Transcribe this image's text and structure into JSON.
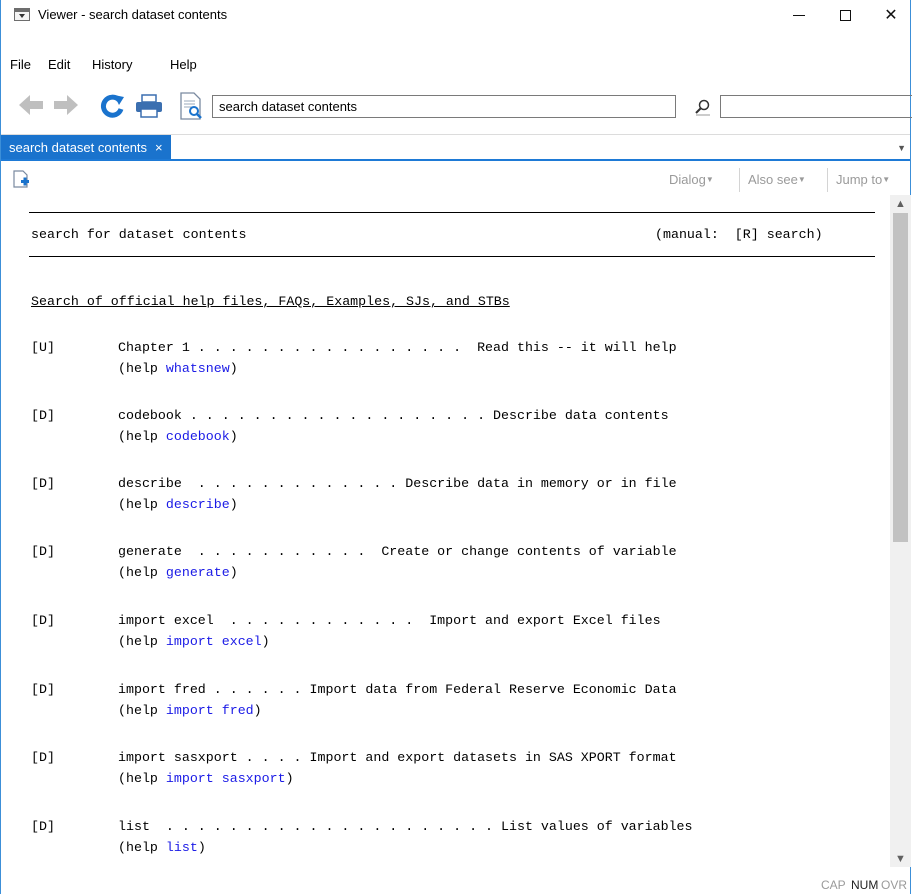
{
  "window": {
    "title": "Viewer - search dataset contents"
  },
  "menu": [
    "File",
    "Edit",
    "History",
    "Help"
  ],
  "toolbar": {
    "address": "search dataset contents",
    "search_value": ""
  },
  "tab": {
    "label": "search dataset contents",
    "close": "×"
  },
  "subbar": {
    "dialog": "Dialog",
    "also_see": "Also see",
    "jump_to": "Jump to"
  },
  "content": {
    "header_title": "search for dataset contents",
    "header_manual": "(manual:  [R] search)",
    "section_title": "Search of official help files, FAQs, Examples, SJs, and STBs",
    "entries": [
      {
        "tag": "[U]",
        "text": "Chapter 1 . . . . . . . . . . . . . . . . .  Read this -- it will help",
        "help_prefix": "(help ",
        "help_link": "whatsnew",
        "help_suffix": ")"
      },
      {
        "tag": "[D]",
        "text": "codebook . . . . . . . . . . . . . . . . . . . Describe data contents",
        "help_prefix": "(help ",
        "help_link": "codebook",
        "help_suffix": ")"
      },
      {
        "tag": "[D]",
        "text": "describe  . . . . . . . . . . . . . Describe data in memory or in file",
        "help_prefix": "(help ",
        "help_link": "describe",
        "help_suffix": ")"
      },
      {
        "tag": "[D]",
        "text": "generate  . . . . . . . . . . .  Create or change contents of variable",
        "help_prefix": "(help ",
        "help_link": "generate",
        "help_suffix": ")"
      },
      {
        "tag": "[D]",
        "text": "import excel  . . . . . . . . . . . .  Import and export Excel files",
        "help_prefix": "(help ",
        "help_link": "import excel",
        "help_suffix": ")"
      },
      {
        "tag": "[D]",
        "text": "import fred . . . . . . Import data from Federal Reserve Economic Data",
        "help_prefix": "(help ",
        "help_link": "import fred",
        "help_suffix": ")"
      },
      {
        "tag": "[D]",
        "text": "import sasxport . . . . Import and export datasets in SAS XPORT format",
        "help_prefix": "(help ",
        "help_link": "import sasxport",
        "help_suffix": ")"
      },
      {
        "tag": "[D]",
        "text": "list  . . . . . . . . . . . . . . . . . . . . . List values of variables",
        "help_prefix": "(help ",
        "help_link": "list",
        "help_suffix": ")"
      }
    ]
  },
  "status": {
    "cap": "CAP",
    "num": "NUM",
    "ovr": "OVR"
  },
  "colors": {
    "accent": "#1a73cd",
    "link": "#1a1ae6",
    "disabled": "#9a9a9a"
  }
}
